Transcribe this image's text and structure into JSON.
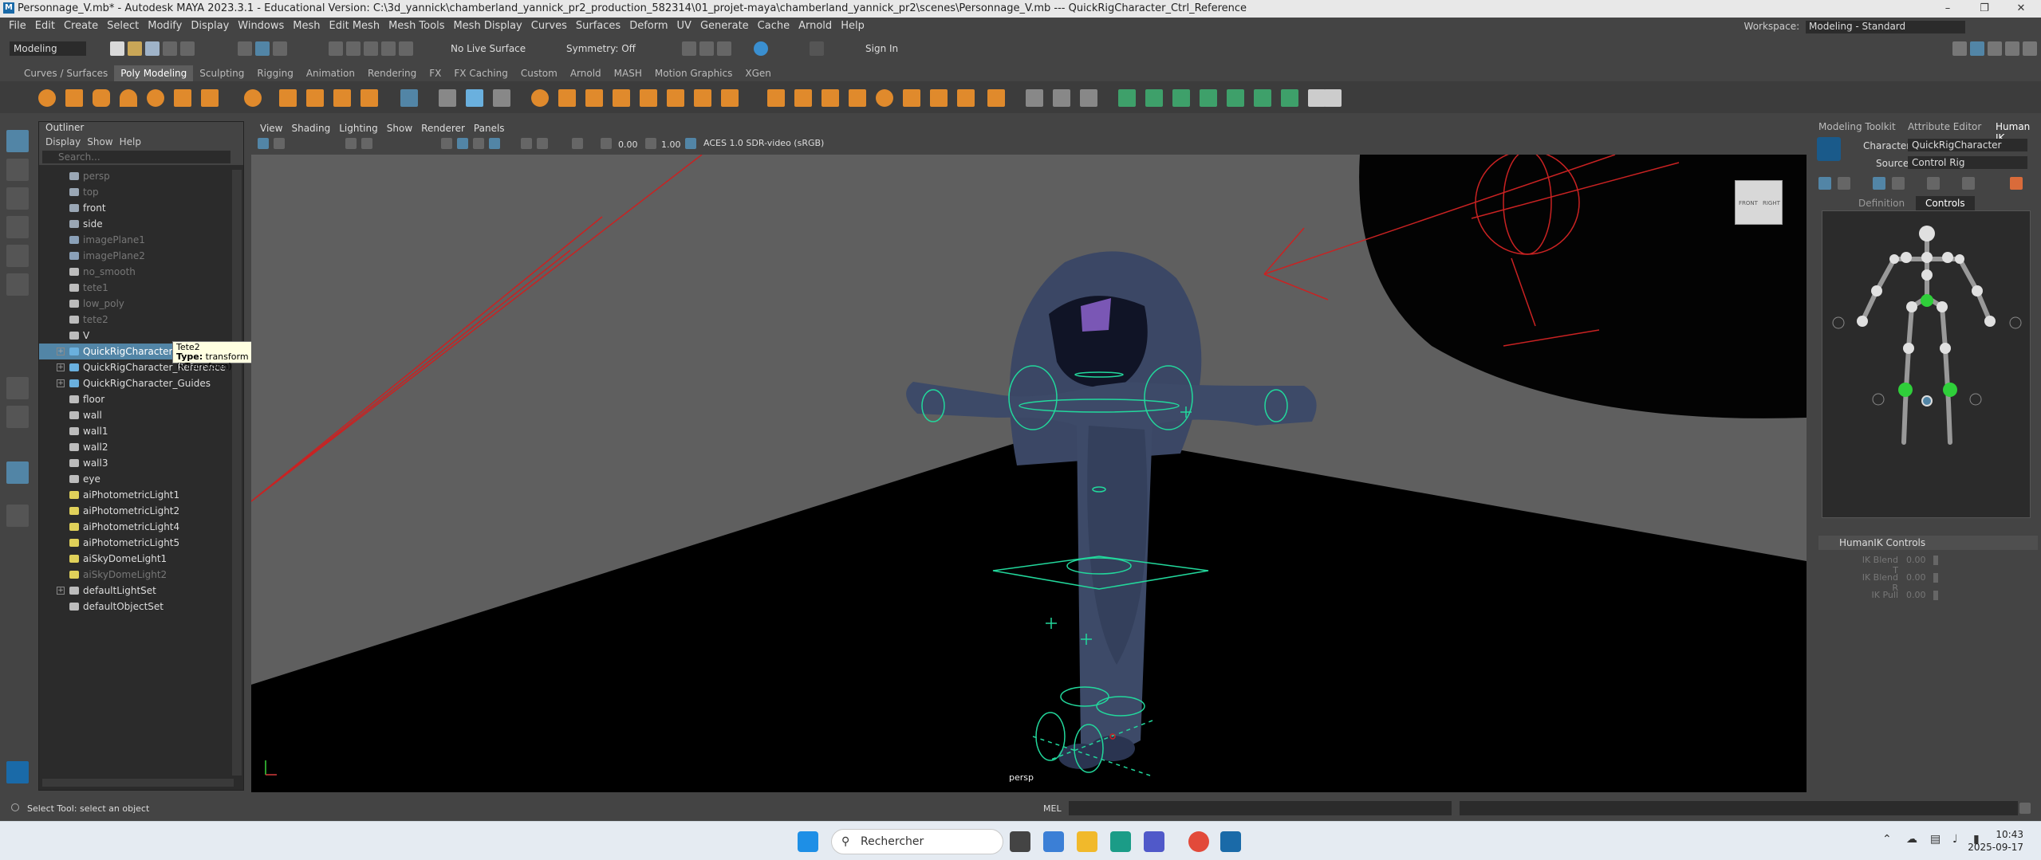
{
  "window": {
    "title": "Personnage_V.mb* - Autodesk MAYA 2023.3.1 - Educational Version: C:\\3d_yannick\\chamberland_yannick_pr2_production_582314\\01_projet-maya\\chamberland_yannick_pr2\\scenes\\Personnage_V.mb  ---  QuickRigCharacter_Ctrl_Reference",
    "app_icon": "maya-logo-icon"
  },
  "menubar": [
    "File",
    "Edit",
    "Create",
    "Select",
    "Modify",
    "Display",
    "Windows",
    "Mesh",
    "Edit Mesh",
    "Mesh Tools",
    "Mesh Display",
    "Curves",
    "Surfaces",
    "Deform",
    "UV",
    "Generate",
    "Cache",
    "Arnold",
    "Help"
  ],
  "workspace": {
    "label": "Workspace:",
    "value": "Modeling - Standard"
  },
  "statusline": {
    "mode": "Modeling",
    "live_surface": "No Live Surface",
    "symmetry": "Symmetry: Off",
    "sign_in": "Sign In"
  },
  "shelf_tabs": [
    "Curves / Surfaces",
    "Poly Modeling",
    "Sculpting",
    "Rigging",
    "Animation",
    "Rendering",
    "FX",
    "FX Caching",
    "Custom",
    "Arnold",
    "MASH",
    "Motion Graphics",
    "XGen"
  ],
  "shelf_active": "Poly Modeling",
  "outliner": {
    "title": "Outliner",
    "menu": [
      "Display",
      "Show",
      "Help"
    ],
    "search_placeholder": "Search...",
    "items": [
      {
        "name": "persp",
        "dim": true,
        "icon": "camera-icon"
      },
      {
        "name": "top",
        "dim": true,
        "icon": "camera-icon"
      },
      {
        "name": "front",
        "dim": false,
        "icon": "camera-icon"
      },
      {
        "name": "side",
        "dim": false,
        "icon": "camera-icon"
      },
      {
        "name": "imagePlane1",
        "dim": true,
        "icon": "image-plane-icon"
      },
      {
        "name": "imagePlane2",
        "dim": true,
        "icon": "image-plane-icon"
      },
      {
        "name": "no_smooth",
        "dim": true,
        "icon": "transform-icon"
      },
      {
        "name": "tete1",
        "dim": true,
        "icon": "transform-icon"
      },
      {
        "name": "low_poly",
        "dim": true,
        "icon": "transform-icon"
      },
      {
        "name": "tete2",
        "dim": true,
        "icon": "transform-icon"
      },
      {
        "name": "V",
        "dim": false,
        "icon": "transform-icon"
      },
      {
        "name": "QuickRigCharacter_Ct",
        "dim": false,
        "icon": "joint-icon",
        "expand": true,
        "selected": true
      },
      {
        "name": "QuickRigCharacter_Reference",
        "dim": false,
        "icon": "joint-icon",
        "expand": true
      },
      {
        "name": "QuickRigCharacter_Guides",
        "dim": false,
        "icon": "joint-icon",
        "expand": true
      },
      {
        "name": "floor",
        "dim": false,
        "icon": "transform-icon"
      },
      {
        "name": "wall",
        "dim": false,
        "icon": "transform-icon"
      },
      {
        "name": "wall1",
        "dim": false,
        "icon": "transform-icon"
      },
      {
        "name": "wall2",
        "dim": false,
        "icon": "transform-icon"
      },
      {
        "name": "wall3",
        "dim": false,
        "icon": "transform-icon"
      },
      {
        "name": "eye",
        "dim": false,
        "icon": "transform-icon"
      },
      {
        "name": "aiPhotometricLight1",
        "dim": false,
        "icon": "light-icon"
      },
      {
        "name": "aiPhotometricLight2",
        "dim": false,
        "icon": "light-icon"
      },
      {
        "name": "aiPhotometricLight4",
        "dim": false,
        "icon": "light-icon"
      },
      {
        "name": "aiPhotometricLight5",
        "dim": false,
        "icon": "light-icon"
      },
      {
        "name": "aiSkyDomeLight1",
        "dim": false,
        "icon": "skydome-icon"
      },
      {
        "name": "aiSkyDomeLight2",
        "dim": true,
        "icon": "skydome-icon"
      },
      {
        "name": "defaultLightSet",
        "dim": false,
        "icon": "set-icon",
        "expand": true
      },
      {
        "name": "defaultObjectSet",
        "dim": false,
        "icon": "set-icon"
      }
    ],
    "tooltip": {
      "line1": "Tete2",
      "line2_label": "Type:",
      "line2_value": "transform (kTransform)"
    }
  },
  "viewport": {
    "menu": [
      "View",
      "Shading",
      "Lighting",
      "Show",
      "Renderer",
      "Panels"
    ],
    "exposure": "0.00",
    "gamma": "1.00",
    "color_space": "ACES 1.0 SDR-video (sRGB)",
    "camera_label": "persp",
    "viewcube_left": "FRONT",
    "viewcube_right": "RIGHT"
  },
  "rightpanel": {
    "tabs": [
      "Modeling Toolkit",
      "Attribute Editor",
      "Human IK"
    ],
    "character_label": "Character:",
    "character_value": "QuickRigCharacter",
    "source_label": "Source:",
    "source_value": "Control Rig",
    "subtabs": [
      "Definition",
      "Controls"
    ],
    "controls_title": "HumanIK Controls",
    "sliders": [
      {
        "label": "IK Blend T",
        "value": "0.00"
      },
      {
        "label": "IK Blend R",
        "value": "0.00"
      },
      {
        "label": "IK Pull",
        "value": "0.00"
      }
    ]
  },
  "cmdline": {
    "status": "Select Tool: select an object",
    "mel": "MEL"
  },
  "taskbar": {
    "search": "Rechercher",
    "time": "10:43",
    "date": "2025-09-17"
  }
}
